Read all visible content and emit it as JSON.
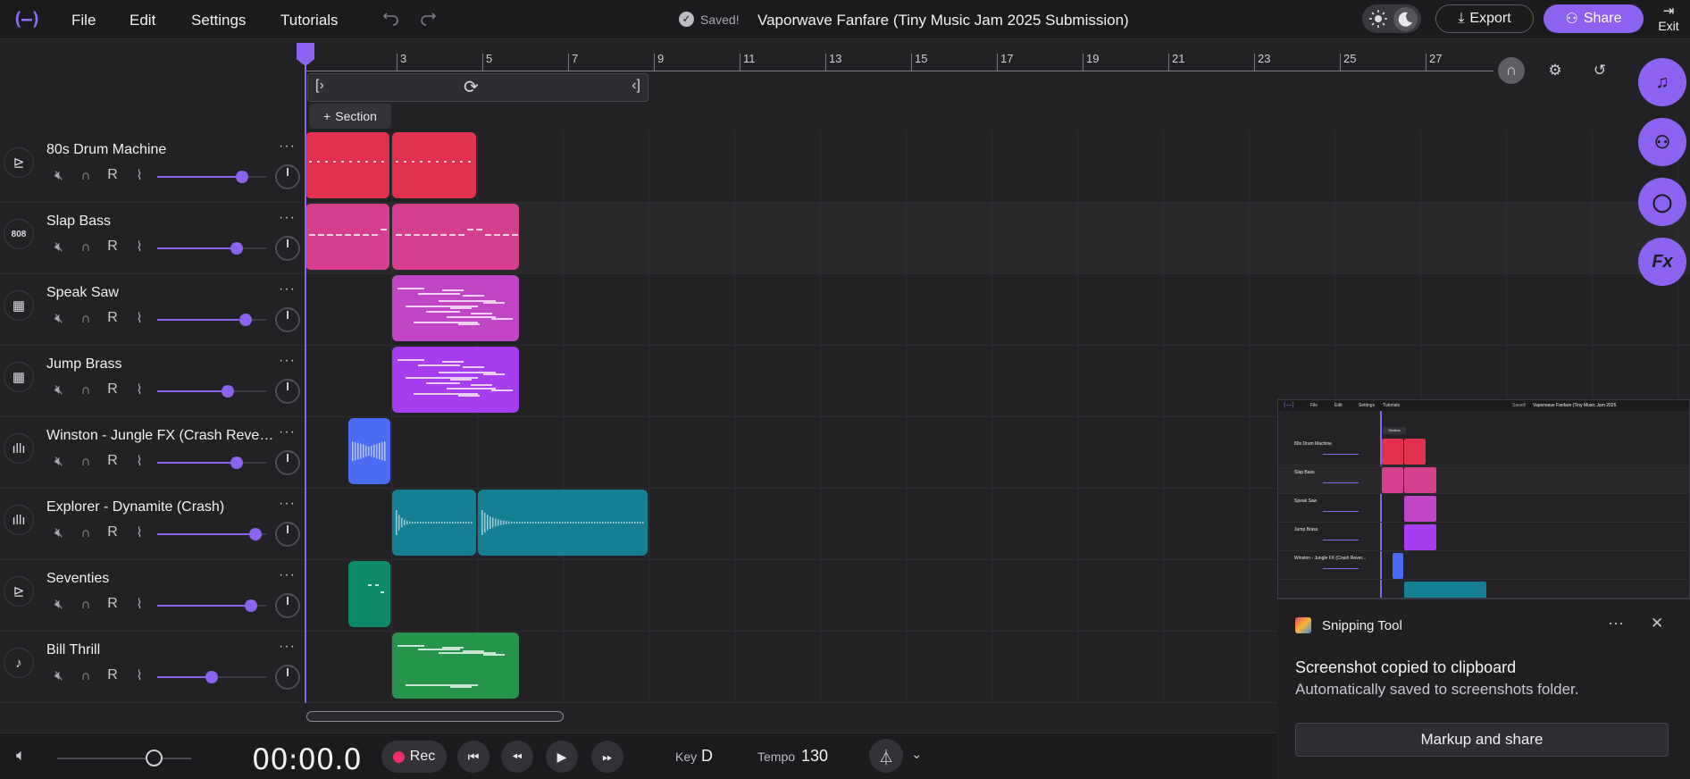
{
  "menu": [
    "File",
    "Edit",
    "Settings",
    "Tutorials"
  ],
  "logo_text": "(—)",
  "status": "Saved!",
  "title": "Vaporwave Fanfare (Tiny Music Jam 2025 Submission)",
  "export_label": "Export",
  "share_label": "Share",
  "exit_label": "Exit",
  "section_label": "Section",
  "ruler": [
    "3",
    "5",
    "7",
    "9",
    "11",
    "13",
    "15",
    "17",
    "19",
    "21",
    "23",
    "25",
    "27"
  ],
  "tracks": [
    {
      "name": "80s Drum Machine",
      "icon": "drum-machine-icon",
      "glyph": "⊵",
      "color": "#e2314e",
      "vol": 0.78
    },
    {
      "name": "Slap Bass",
      "icon": "bass-808-icon",
      "glyph": "808",
      "color": "#d43f8e",
      "vol": 0.73
    },
    {
      "name": "Speak Saw",
      "icon": "keyboard-icon",
      "glyph": "▦",
      "color": "#c046c6",
      "vol": 0.81
    },
    {
      "name": "Jump Brass",
      "icon": "keyboard-icon",
      "glyph": "▦",
      "color": "#a63ef0",
      "vol": 0.65
    },
    {
      "name": "Winston - Jungle FX (Crash Reverb Down)",
      "icon": "waveform-icon",
      "glyph": "ıllı",
      "color": "#4a6cf5",
      "vol": 0.73
    },
    {
      "name": "Explorer - Dynamite (Crash)",
      "icon": "waveform-icon",
      "glyph": "ıllı",
      "color": "#157f93",
      "vol": 0.9
    },
    {
      "name": "Seventies",
      "icon": "drum-machine-icon",
      "glyph": "⊵",
      "color": "#0c8a6a",
      "vol": 0.86
    },
    {
      "name": "Bill Thrill",
      "icon": "guitar-icon",
      "glyph": "♪",
      "color": "#26944b",
      "vol": 0.5
    }
  ],
  "track_ctrl": {
    "record": "R"
  },
  "transport": {
    "time": "00:00.0",
    "rec_label": "Rec",
    "key_label": "Key",
    "key_value": "D",
    "tempo_label": "Tempo",
    "tempo_value": "130"
  },
  "mini": {
    "menu": [
      "File",
      "Edit",
      "Settings",
      "Tutorials"
    ],
    "status": "Saved!",
    "title": "Vaporwave Fanfare (Tiny Music Jam 2025",
    "section": "Section",
    "tracks": [
      "80s Drum Machine",
      "Slap Bass",
      "Speak Saw",
      "Jump Brass",
      "Winston - Jungle FX (Crash Rever..."
    ]
  },
  "toast": {
    "app": "Snipping Tool",
    "heading": "Screenshot copied to clipboard",
    "sub": "Automatically saved to screenshots folder.",
    "action": "Markup and share"
  }
}
